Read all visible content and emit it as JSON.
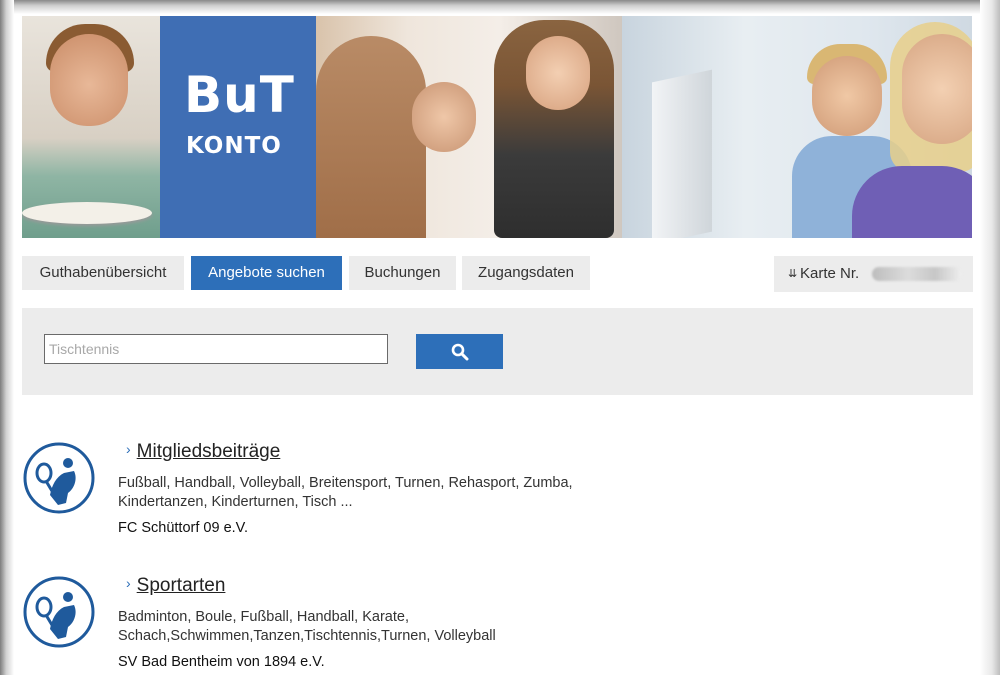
{
  "banner": {
    "logo_big": "BuT",
    "logo_small": "KONTO"
  },
  "nav": {
    "tabs": [
      {
        "label": "Guthabenübersicht",
        "active": false
      },
      {
        "label": "Angebote suchen",
        "active": true
      },
      {
        "label": "Buchungen",
        "active": false
      },
      {
        "label": "Zugangsdaten",
        "active": false
      }
    ],
    "card_label": "Karte Nr.",
    "card_arrow": "⇊"
  },
  "search": {
    "value": "",
    "placeholder": "Tischtennis",
    "button_icon": "search-icon"
  },
  "results": [
    {
      "title": "Mitgliedsbeiträge",
      "desc": "Fußball, Handball, Volleyball, Breitensport, Turnen, Rehasport, Zumba, Kindertanzen, Kinderturnen, Tisch ...",
      "org": "FC Schüttorf 09 e.V.",
      "icon": "sport-person-icon"
    },
    {
      "title": "Sportarten",
      "desc": "Badminton, Boule, Fußball, Handball, Karate, Schach,Schwimmen,Tanzen,Tischtennis,Turnen, Volleyball",
      "org": "SV Bad Bentheim von 1894 e.V.",
      "icon": "sport-person-icon"
    }
  ],
  "colors": {
    "accent": "#2d6fb9",
    "logo_bg": "#3f6eb4",
    "panel_bg": "#ececec"
  }
}
